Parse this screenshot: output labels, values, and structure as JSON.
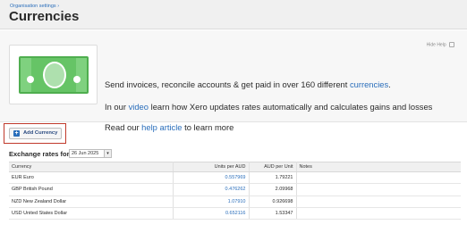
{
  "header": {
    "breadcrumb": "Organisation settings",
    "breadcrumb_sep": "›",
    "title": "Currencies"
  },
  "banner": {
    "hide_help": "Hide Help",
    "line1_text": "Send invoices, reconcile accounts & get paid in over 160 different ",
    "line1_link": "currencies",
    "line1_end": ".",
    "line2_pre": "In our ",
    "line2_link": "video",
    "line2_post": " learn how Xero updates rates automatically and calculates gains and losses",
    "line3_pre": "Read our ",
    "line3_link": "help article",
    "line3_post": " to learn more"
  },
  "actions": {
    "add_currency": "Add Currency"
  },
  "exchange": {
    "label": "Exchange rates for",
    "date": "26 Jun 2025",
    "date_arrow": "▾"
  },
  "table": {
    "headers": {
      "currency": "Currency",
      "units": "Units per AUD",
      "aud": "AUD per Unit",
      "notes": "Notes"
    },
    "rows": [
      {
        "currency": "EUR Euro",
        "units": "0.557969",
        "aud": "1.79221",
        "notes": ""
      },
      {
        "currency": "GBP British Pound",
        "units": "0.476262",
        "aud": "2.09968",
        "notes": ""
      },
      {
        "currency": "NZD New Zealand Dollar",
        "units": "1.07910",
        "aud": "0.926698",
        "notes": ""
      },
      {
        "currency": "USD United States Dollar",
        "units": "0.652116",
        "aud": "1.53347",
        "notes": ""
      }
    ]
  },
  "colors": {
    "link": "#2a6ebb",
    "highlight_border": "#c0392b",
    "bill_green": "#66c466"
  },
  "icons": {
    "add": "plus-icon",
    "date": "chevron-down-icon",
    "help": "help-icon",
    "banner": "banknote-icon"
  }
}
